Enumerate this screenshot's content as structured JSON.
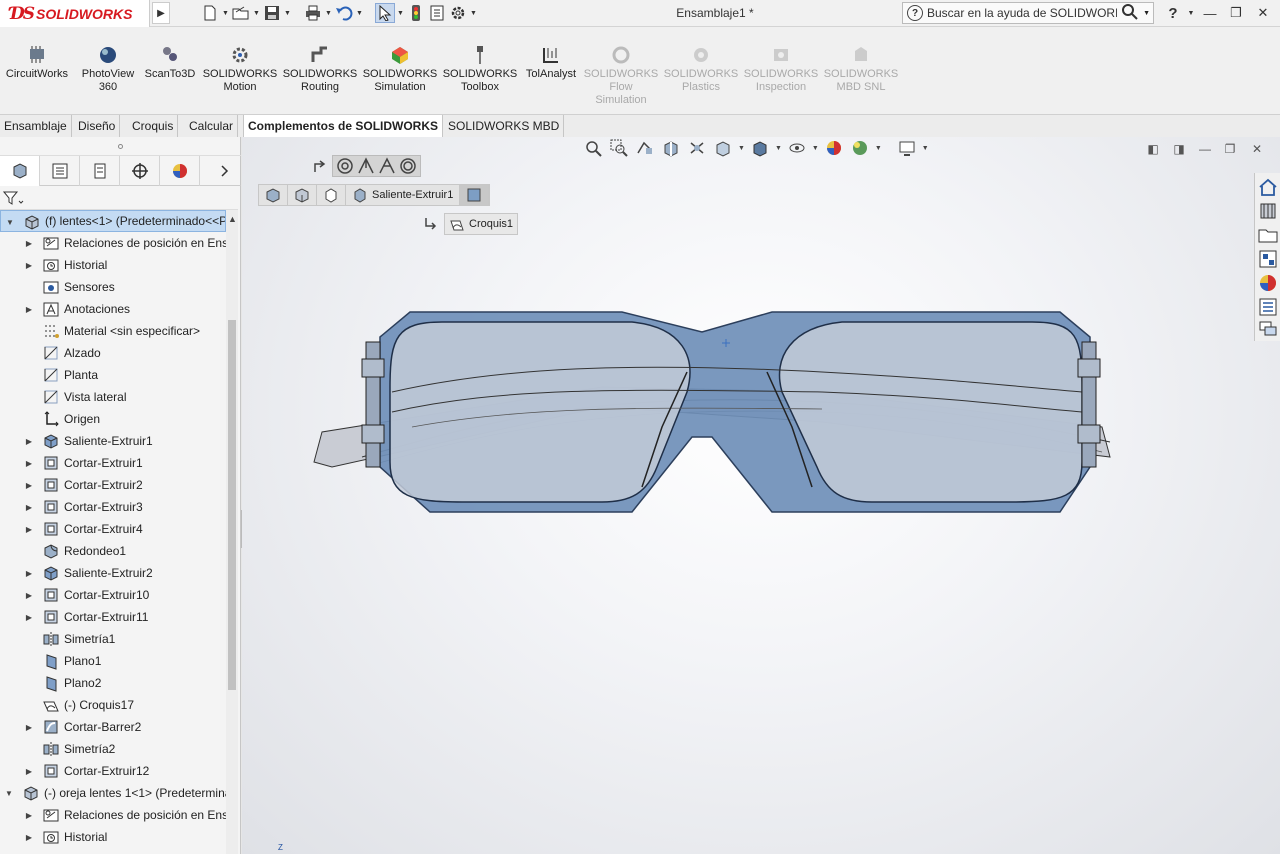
{
  "app": {
    "brand": "SOLIDWORKS",
    "doc_title": "Ensamblaje1 *",
    "help_placeholder": "Buscar en la ayuda de SOLIDWORKS"
  },
  "quick_access": [
    "new-doc-icon",
    "open-folder-icon",
    "save-icon",
    "print-icon",
    "undo-icon",
    "select-arrow-icon",
    "rebuild-traffic-light-icon",
    "file-properties-icon",
    "options-gear-icon"
  ],
  "window_controls": [
    "help-icon",
    "minimize-icon",
    "restore-icon",
    "close-icon"
  ],
  "ribbon": [
    {
      "label_1": "CircuitWorks",
      "label_2": "",
      "label_3": "",
      "enabled": true
    },
    {
      "label_1": "PhotoView",
      "label_2": "360",
      "label_3": "",
      "enabled": true
    },
    {
      "label_1": "ScanTo3D",
      "label_2": "",
      "label_3": "",
      "enabled": true
    },
    {
      "label_1": "SOLIDWORKS",
      "label_2": "Motion",
      "label_3": "",
      "enabled": true
    },
    {
      "label_1": "SOLIDWORKS",
      "label_2": "Routing",
      "label_3": "",
      "enabled": true
    },
    {
      "label_1": "SOLIDWORKS",
      "label_2": "Simulation",
      "label_3": "",
      "enabled": true
    },
    {
      "label_1": "SOLIDWORKS",
      "label_2": "Toolbox",
      "label_3": "",
      "enabled": true
    },
    {
      "label_1": "TolAnalyst",
      "label_2": "",
      "label_3": "",
      "enabled": true
    },
    {
      "label_1": "SOLIDWORKS",
      "label_2": "Flow",
      "label_3": "Simulation",
      "enabled": false
    },
    {
      "label_1": "SOLIDWORKS",
      "label_2": "Plastics",
      "label_3": "",
      "enabled": false
    },
    {
      "label_1": "SOLIDWORKS",
      "label_2": "Inspection",
      "label_3": "",
      "enabled": false
    },
    {
      "label_1": "SOLIDWORKS",
      "label_2": "MBD SNL",
      "label_3": "",
      "enabled": false
    }
  ],
  "tabs": [
    {
      "label": "Ensamblaje",
      "active": false
    },
    {
      "label": "Diseño",
      "active": false
    },
    {
      "label": "Croquis",
      "active": false
    },
    {
      "label": "Calcular",
      "active": false
    },
    {
      "label": "Complementos de SOLIDWORKS",
      "active": true
    },
    {
      "label": "SOLIDWORKS MBD",
      "active": false
    }
  ],
  "tree": [
    {
      "label": "(f) lentes<1> (Predeterminado<<P",
      "level": 0,
      "expandable": true,
      "expanded": true,
      "icon": "part-icon",
      "selected": true
    },
    {
      "label": "Relaciones de posición en Ens",
      "level": 1,
      "expandable": true,
      "icon": "mates-folder-icon"
    },
    {
      "label": "Historial",
      "level": 1,
      "expandable": true,
      "icon": "history-folder-icon"
    },
    {
      "label": "Sensores",
      "level": 1,
      "expandable": false,
      "icon": "sensors-folder-icon"
    },
    {
      "label": "Anotaciones",
      "level": 1,
      "expandable": true,
      "icon": "annotations-icon"
    },
    {
      "label": "Material <sin especificar>",
      "level": 1,
      "expandable": false,
      "icon": "material-icon"
    },
    {
      "label": "Alzado",
      "level": 1,
      "expandable": false,
      "icon": "plane-icon"
    },
    {
      "label": "Planta",
      "level": 1,
      "expandable": false,
      "icon": "plane-icon"
    },
    {
      "label": "Vista lateral",
      "level": 1,
      "expandable": false,
      "icon": "plane-icon"
    },
    {
      "label": "Origen",
      "level": 1,
      "expandable": false,
      "icon": "origin-icon"
    },
    {
      "label": "Saliente-Extruir1",
      "level": 1,
      "expandable": true,
      "icon": "boss-extrude-icon"
    },
    {
      "label": "Cortar-Extruir1",
      "level": 1,
      "expandable": true,
      "icon": "cut-extrude-icon"
    },
    {
      "label": "Cortar-Extruir2",
      "level": 1,
      "expandable": true,
      "icon": "cut-extrude-icon"
    },
    {
      "label": "Cortar-Extruir3",
      "level": 1,
      "expandable": true,
      "icon": "cut-extrude-icon"
    },
    {
      "label": "Cortar-Extruir4",
      "level": 1,
      "expandable": true,
      "icon": "cut-extrude-icon"
    },
    {
      "label": "Redondeo1",
      "level": 1,
      "expandable": false,
      "icon": "fillet-icon"
    },
    {
      "label": "Saliente-Extruir2",
      "level": 1,
      "expandable": true,
      "icon": "boss-extrude-icon"
    },
    {
      "label": "Cortar-Extruir10",
      "level": 1,
      "expandable": true,
      "icon": "cut-extrude-icon"
    },
    {
      "label": "Cortar-Extruir11",
      "level": 1,
      "expandable": true,
      "icon": "cut-extrude-icon"
    },
    {
      "label": "Simetría1",
      "level": 1,
      "expandable": false,
      "icon": "mirror-icon"
    },
    {
      "label": "Plano1",
      "level": 1,
      "expandable": false,
      "icon": "ref-plane-icon"
    },
    {
      "label": "Plano2",
      "level": 1,
      "expandable": false,
      "icon": "ref-plane-icon"
    },
    {
      "label": "(-) Croquis17",
      "level": 1,
      "expandable": false,
      "icon": "sketch-icon"
    },
    {
      "label": "Cortar-Barrer2",
      "level": 1,
      "expandable": true,
      "icon": "cut-sweep-icon"
    },
    {
      "label": "Simetría2",
      "level": 1,
      "expandable": false,
      "icon": "mirror-icon"
    },
    {
      "label": "Cortar-Extruir12",
      "level": 1,
      "expandable": true,
      "icon": "cut-extrude-icon"
    },
    {
      "label": "(-) oreja lentes 1<1> (Predetermina",
      "level": 0,
      "expandable": true,
      "expanded": true,
      "icon": "part-icon"
    },
    {
      "label": "Relaciones de posición en Ens",
      "level": 1,
      "expandable": true,
      "icon": "mates-folder-icon"
    },
    {
      "label": "Historial",
      "level": 1,
      "expandable": true,
      "icon": "history-folder-icon"
    }
  ],
  "breadcrumb": {
    "feature_label": "Saliente-Extruir1",
    "sketch_label": "Croquis1"
  },
  "triad_z": "Z",
  "colors": {
    "accent": "#1f5fa8",
    "frame": "#6f8fb8",
    "selection": "#c4dbf3",
    "brand_red": "#d71920"
  }
}
